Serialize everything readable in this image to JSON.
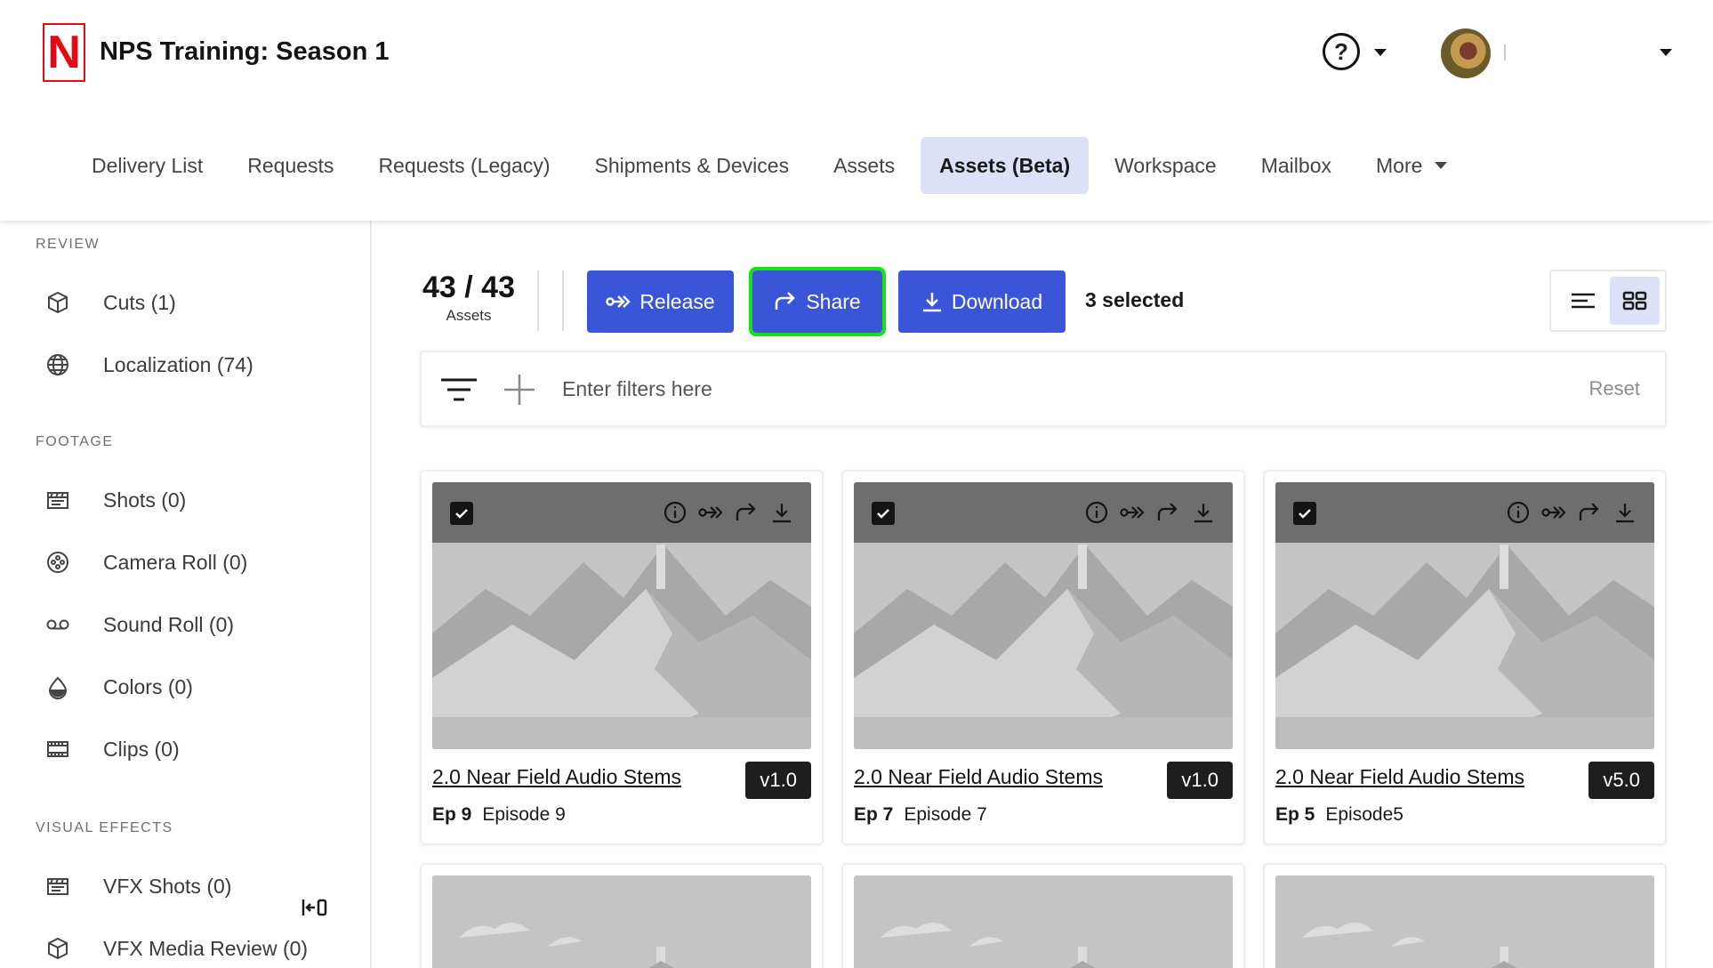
{
  "header": {
    "logo_letter": "N",
    "project_title": "NPS Training: Season 1",
    "help_symbol": "?"
  },
  "nav": {
    "items": [
      {
        "label": "Delivery List"
      },
      {
        "label": "Requests"
      },
      {
        "label": "Requests (Legacy)"
      },
      {
        "label": "Shipments & Devices"
      },
      {
        "label": "Assets"
      },
      {
        "label": "Assets (Beta)",
        "active": true
      },
      {
        "label": "Workspace"
      },
      {
        "label": "Mailbox"
      },
      {
        "label": "More"
      }
    ]
  },
  "sidebar": {
    "sections": [
      {
        "title": "REVIEW",
        "items": [
          {
            "label": "Cuts (1)",
            "icon": "cube-icon"
          },
          {
            "label": "Localization (74)",
            "icon": "globe-icon"
          }
        ]
      },
      {
        "title": "FOOTAGE",
        "items": [
          {
            "label": "Shots (0)",
            "icon": "clapper-icon"
          },
          {
            "label": "Camera Roll (0)",
            "icon": "film-reel-icon"
          },
          {
            "label": "Sound Roll (0)",
            "icon": "voicemail-icon"
          },
          {
            "label": "Colors (0)",
            "icon": "drop-icon"
          },
          {
            "label": "Clips (0)",
            "icon": "film-strip-icon"
          }
        ]
      },
      {
        "title": "VISUAL EFFECTS",
        "items": [
          {
            "label": "VFX Shots (0)",
            "icon": "clapper-icon"
          },
          {
            "label": "VFX Media Review (0)",
            "icon": "cube-icon"
          }
        ]
      }
    ]
  },
  "toolbar": {
    "count": "43 / 43",
    "count_label": "Assets",
    "release_label": "Release",
    "share_label": "Share",
    "download_label": "Download",
    "selected_text": "3 selected",
    "accent_color": "#3b55d9",
    "highlight_color": "#16e016"
  },
  "filters": {
    "placeholder": "Enter filters here",
    "reset_label": "Reset"
  },
  "cards": [
    {
      "title": "2.0 Near Field Audio Stems",
      "version": "v1.0",
      "ep_code": "Ep 9",
      "ep_name": "Episode 9",
      "checked": true
    },
    {
      "title": "2.0 Near Field Audio Stems",
      "version": "v1.0",
      "ep_code": "Ep 7",
      "ep_name": "Episode 7",
      "checked": true
    },
    {
      "title": "2.0 Near Field Audio Stems",
      "version": "v5.0",
      "ep_code": "Ep 5",
      "ep_name": "Episode5",
      "checked": true
    }
  ]
}
